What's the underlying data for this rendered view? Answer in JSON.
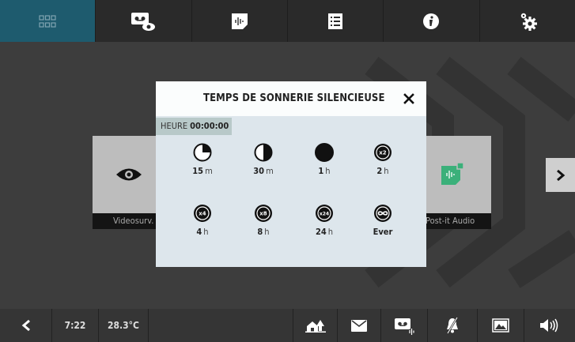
{
  "topbar": {
    "items": [
      {
        "name": "home-grid-icon",
        "active": true
      },
      {
        "name": "video-monitor-icon",
        "active": false
      },
      {
        "name": "audio-note-icon",
        "active": false
      },
      {
        "name": "list-icon",
        "active": false
      },
      {
        "name": "info-icon",
        "active": false
      },
      {
        "name": "settings-icon",
        "active": false
      }
    ]
  },
  "background": {
    "tile_video_label": "Videosurv.",
    "tile_postit_label": "Post-it Audio"
  },
  "dialog": {
    "title": "TEMPS DE SONNERIE SILENCIEUSE",
    "time_label": "HEURE",
    "time_value": "00:00:00",
    "options": [
      {
        "icon": "quarter-circle-icon",
        "value": "15",
        "unit": "m"
      },
      {
        "icon": "half-circle-icon",
        "value": "30",
        "unit": "m"
      },
      {
        "icon": "full-circle-icon",
        "value": "1",
        "unit": "h"
      },
      {
        "icon": "x2-icon",
        "badge": "x2",
        "value": "2",
        "unit": "h"
      },
      {
        "icon": "x4-icon",
        "badge": "x4",
        "value": "4",
        "unit": "h"
      },
      {
        "icon": "x8-icon",
        "badge": "x8",
        "value": "8",
        "unit": "h"
      },
      {
        "icon": "x24-icon",
        "badge": "x24",
        "value": "24",
        "unit": "h"
      },
      {
        "icon": "infinity-icon",
        "value": "Ever",
        "unit": ""
      }
    ]
  },
  "bottombar": {
    "time": "7:22",
    "temperature": "28.3°C"
  },
  "colors": {
    "accent": "#1e5b6e",
    "dialog_bg": "#dde6ec",
    "chip_bg": "#b8c9c9"
  }
}
